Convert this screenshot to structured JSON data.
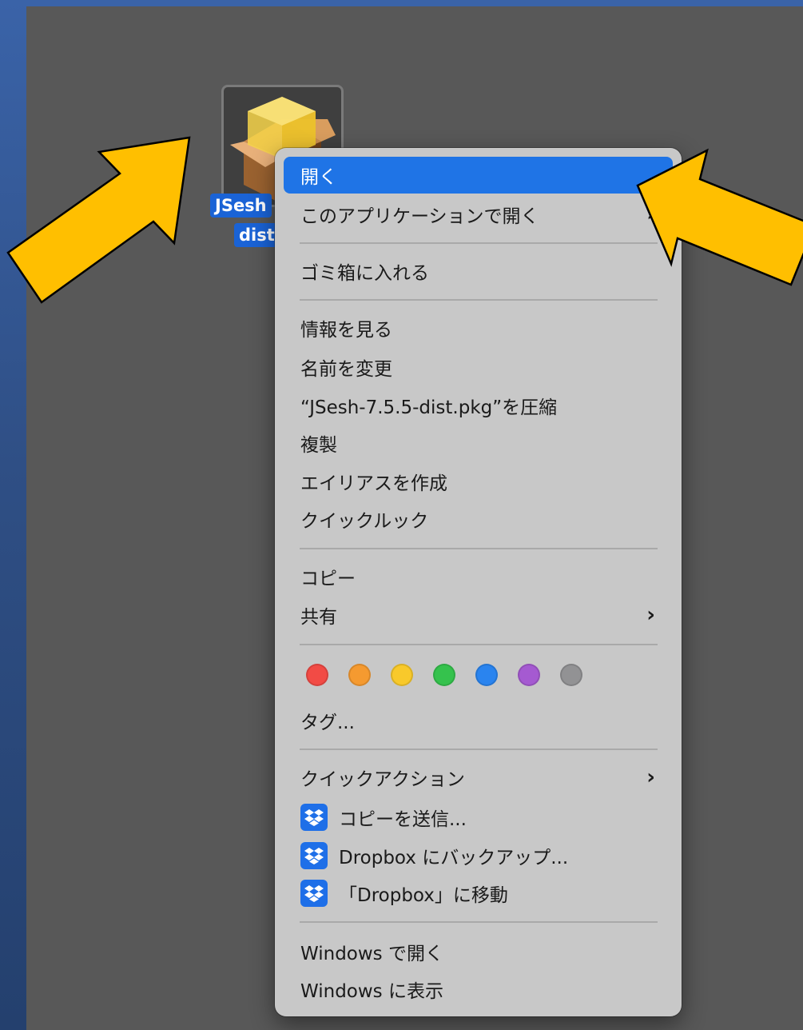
{
  "file": {
    "name_line1": "JSesh",
    "name_line2": "dist"
  },
  "menu": {
    "open": "開く",
    "open_with": "このアプリケーションで開く",
    "trash": "ゴミ箱に入れる",
    "get_info": "情報を見る",
    "rename": "名前を変更",
    "compress": "“JSesh-7.5.5-dist.pkg”を圧縮",
    "duplicate": "複製",
    "make_alias": "エイリアスを作成",
    "quick_look": "クイックルック",
    "copy": "コピー",
    "share": "共有",
    "tags": "タグ...",
    "quick_actions": "クイックアクション",
    "send_copy": "コピーを送信...",
    "backup_dropbox": "Dropbox にバックアップ...",
    "move_dropbox": "「Dropbox」に移動",
    "open_windows": "Windows で開く",
    "show_windows": "Windows に表示"
  },
  "tag_colors": [
    "#f24b45",
    "#f59a30",
    "#f8c92b",
    "#35c24d",
    "#2a84ef",
    "#a55ad1",
    "#929294"
  ],
  "colors": {
    "highlight": "#1f74e6",
    "arrow": "#ffbf00",
    "dropbox": "#1e6fe8"
  }
}
